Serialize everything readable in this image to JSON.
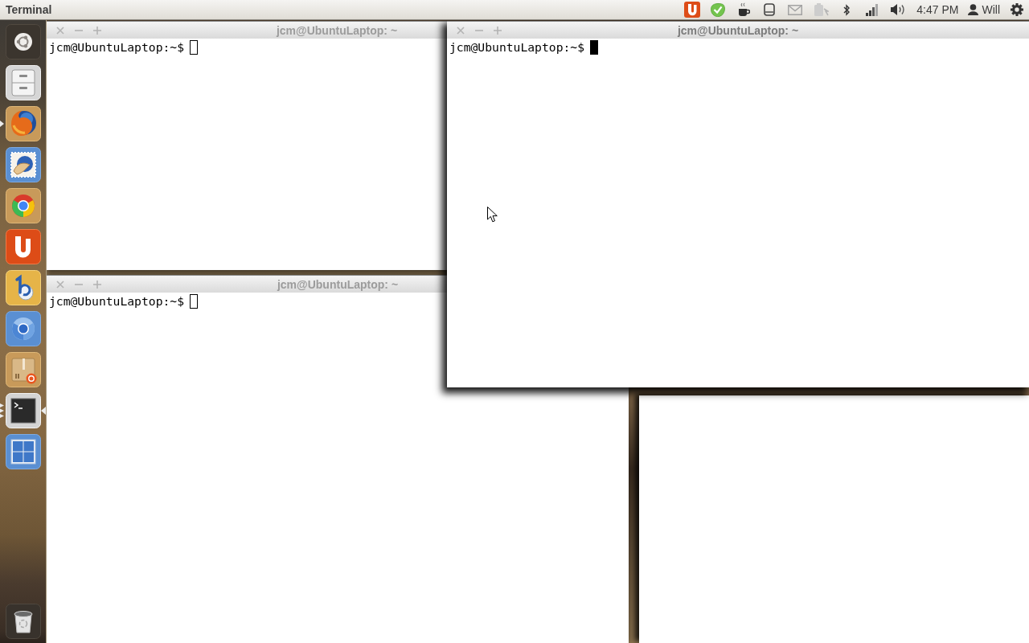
{
  "top_panel": {
    "app_title": "Terminal",
    "indicators": [
      {
        "kind": "uletter"
      },
      {
        "kind": "check"
      },
      {
        "kind": "cup"
      },
      {
        "kind": "tablet"
      },
      {
        "kind": "envelope"
      },
      {
        "kind": "battery"
      },
      {
        "kind": "bluetooth"
      },
      {
        "kind": "signal"
      },
      {
        "kind": "speaker"
      }
    ],
    "clock": "4:47 PM",
    "user": "Will"
  },
  "launcher": {
    "items": [
      {
        "kind": "home",
        "running": false,
        "multiple_windows": false,
        "focused": false
      },
      {
        "kind": "cabinet",
        "running": false,
        "multiple_windows": false,
        "focused": false
      },
      {
        "kind": "foxglobe",
        "running": true,
        "multiple_windows": false,
        "focused": false
      },
      {
        "kind": "stamp",
        "running": false,
        "multiple_windows": false,
        "focused": false
      },
      {
        "kind": "tricolor",
        "running": false,
        "multiple_windows": false,
        "focused": false
      },
      {
        "kind": "uletter",
        "running": false,
        "multiple_windows": false,
        "focused": false
      },
      {
        "kind": "bletter",
        "running": false,
        "multiple_windows": false,
        "focused": false
      },
      {
        "kind": "ring",
        "running": false,
        "multiple_windows": false,
        "focused": false
      },
      {
        "kind": "package",
        "running": false,
        "multiple_windows": false,
        "focused": false
      },
      {
        "kind": "terminal",
        "running": true,
        "multiple_windows": true,
        "focused": true
      },
      {
        "kind": "grid",
        "running": false,
        "multiple_windows": false,
        "focused": false
      },
      {
        "kind": "trash",
        "running": false,
        "multiple_windows": false,
        "focused": false
      }
    ]
  },
  "windows": [
    {
      "kind": "terminal",
      "title": "jcm@UbuntuLaptop: ~",
      "prompt": "jcm@UbuntuLaptop:~$",
      "focused": false
    },
    {
      "kind": "terminal",
      "title": "jcm@UbuntuLaptop: ~",
      "prompt": "jcm@UbuntuLaptop:~$",
      "focused": true
    },
    {
      "kind": "terminal",
      "title": "jcm@UbuntuLaptop: ~",
      "prompt": "jcm@UbuntuLaptop:~$",
      "focused": false
    },
    {
      "kind": "blank"
    }
  ]
}
